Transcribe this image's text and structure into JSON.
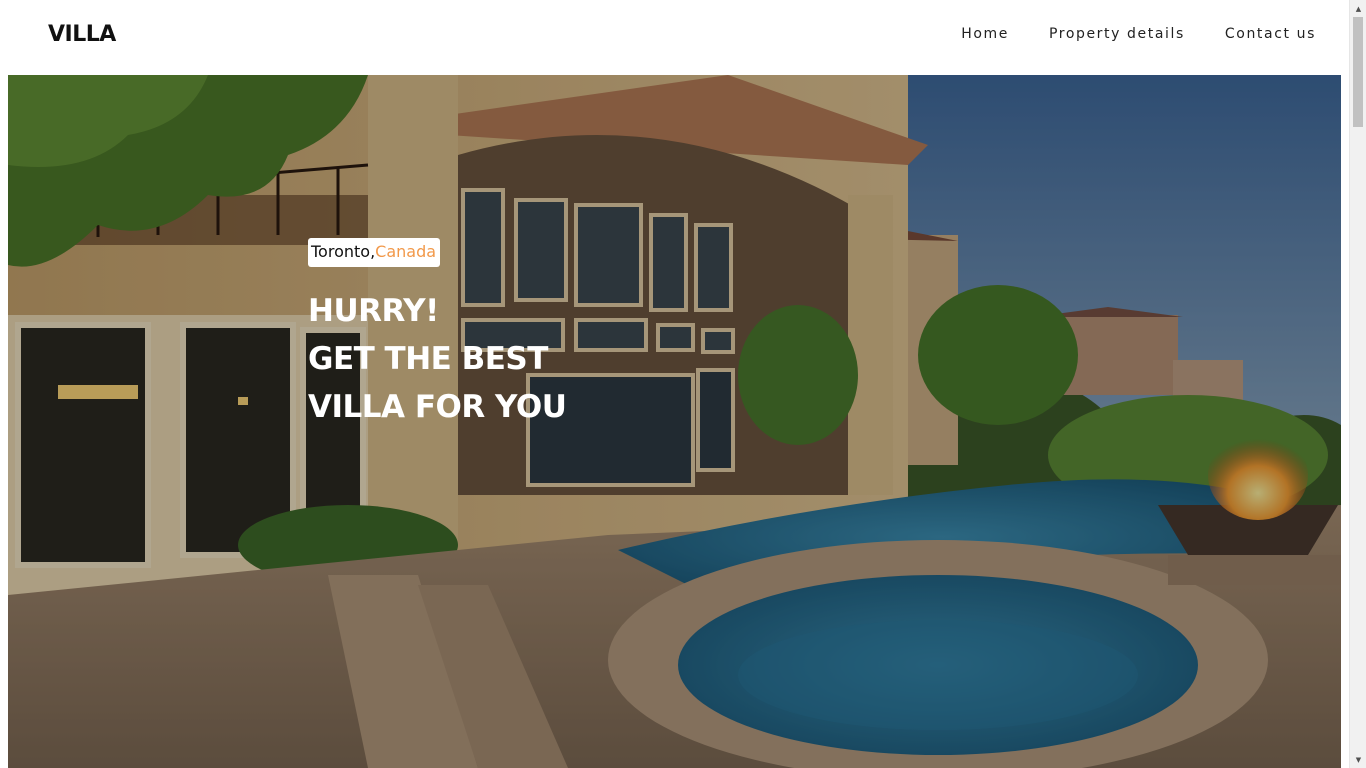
{
  "header": {
    "logo": "VILLA",
    "nav": [
      {
        "label": "Home"
      },
      {
        "label": "Property details"
      },
      {
        "label": "Contact us"
      }
    ]
  },
  "hero": {
    "location": {
      "city": "Toronto,",
      "country": "Canada"
    },
    "headline": [
      "HURRY!",
      "GET THE BEST",
      "VILLA FOR YOU"
    ],
    "image_icon": "villa-pool-photo"
  },
  "scrollbar": {
    "up_icon": "scroll-up-arrow-icon",
    "down_icon": "scroll-down-arrow-icon"
  },
  "colors": {
    "accent": "#f2994a",
    "text_dark": "#111111",
    "headline": "#ffffff"
  }
}
